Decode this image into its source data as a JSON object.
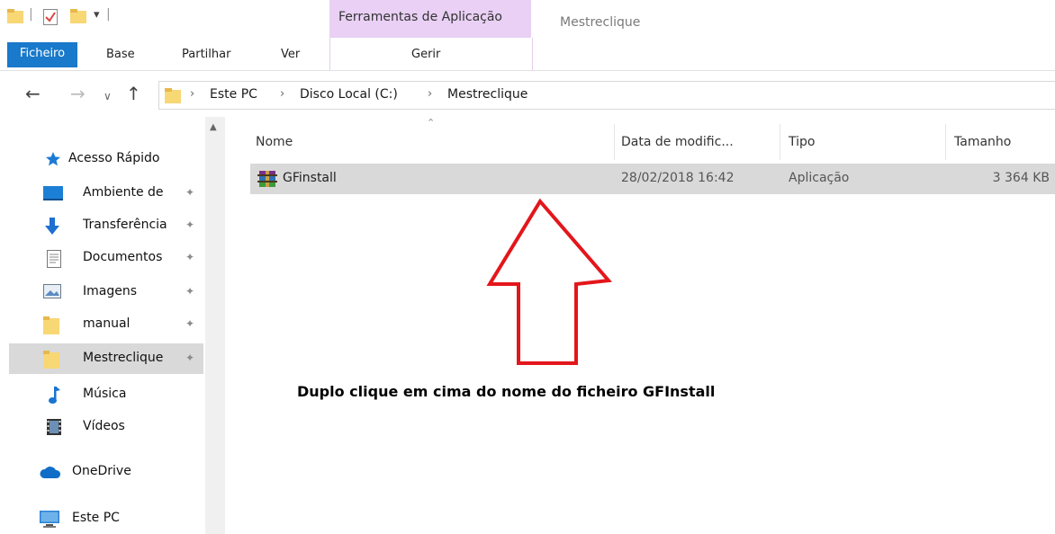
{
  "titlebar": {
    "context_group": "Ferramentas de Aplicação",
    "window_title": "Mestreclique"
  },
  "ribbon": {
    "tabs": [
      "Ficheiro",
      "Base",
      "Partilhar",
      "Ver",
      "Gerir"
    ]
  },
  "address": {
    "crumbs": [
      "Este PC",
      "Disco Local (C:)",
      "Mestreclique"
    ]
  },
  "navpane": {
    "items": [
      {
        "label": "Acesso Rápido",
        "icon": "star-icon",
        "pinned": false
      },
      {
        "label": "Ambiente de",
        "icon": "desktop-icon",
        "pinned": true
      },
      {
        "label": "Transferência",
        "icon": "download-icon",
        "pinned": true
      },
      {
        "label": "Documentos",
        "icon": "documents-icon",
        "pinned": true
      },
      {
        "label": "Imagens",
        "icon": "pictures-icon",
        "pinned": true
      },
      {
        "label": "manual",
        "icon": "folder-icon",
        "pinned": true
      },
      {
        "label": "Mestreclique",
        "icon": "folder-icon",
        "pinned": true,
        "selected": true
      },
      {
        "label": "Música",
        "icon": "music-icon",
        "pinned": false
      },
      {
        "label": "Vídeos",
        "icon": "videos-icon",
        "pinned": false
      },
      {
        "label": "OneDrive",
        "icon": "onedrive-icon",
        "pinned": false
      },
      {
        "label": "Este PC",
        "icon": "pc-icon",
        "pinned": false
      }
    ]
  },
  "filelist": {
    "columns": [
      "Nome",
      "Data de modific...",
      "Tipo",
      "Tamanho"
    ],
    "rows": [
      {
        "name": "GFinstall",
        "date": "28/02/2018 16:42",
        "type": "Aplicação",
        "size": "3 364 KB",
        "icon": "winrar-installer-icon"
      }
    ]
  },
  "annotation": {
    "text": "Duplo clique em cima do nome do ficheiro GFInstall",
    "arrow_color": "#e3161b"
  },
  "colors": {
    "ficheiro_tab": "#1979ca",
    "context_tab": "#e9d0f4",
    "selection": "#d9d9d9",
    "folder": "#f8d775"
  }
}
